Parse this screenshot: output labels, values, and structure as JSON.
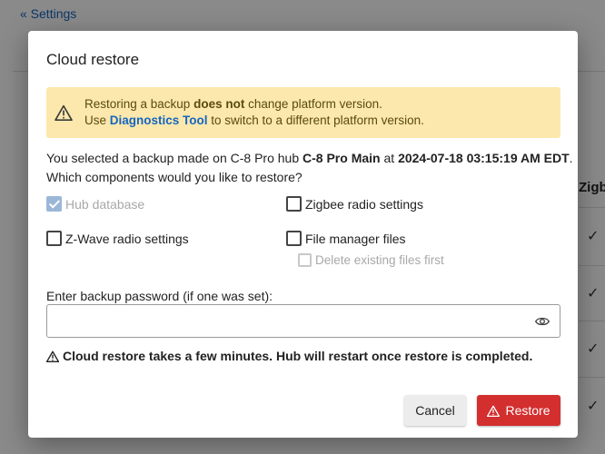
{
  "background": {
    "back_link": "« Settings",
    "column_header": "Zigb",
    "check_glyph": "✓"
  },
  "modal": {
    "title": "Cloud restore",
    "warning": {
      "icon": "warning-icon",
      "line1_pre": "Restoring a backup ",
      "line1_bold": "does not",
      "line1_post": " change platform version.",
      "line2_pre": "Use ",
      "line2_link": "Diagnostics Tool",
      "line2_post": " to switch to a different platform version."
    },
    "description": {
      "pre": "You selected a backup made on C-8 Pro hub ",
      "hub_name": "C-8 Pro Main",
      "mid": " at ",
      "timestamp": "2024-07-18 03:15:19 AM EDT",
      "post": ".",
      "question": "Which components would you like to restore?"
    },
    "options": {
      "hub_database": "Hub database",
      "zigbee": "Zigbee radio settings",
      "zwave": "Z-Wave radio settings",
      "file_manager": "File manager files",
      "delete_existing": "Delete existing files first"
    },
    "password": {
      "label": "Enter backup password (if one was set):",
      "value": "",
      "placeholder": ""
    },
    "notice": "Cloud restore takes a few minutes. Hub will restart once restore is completed.",
    "buttons": {
      "cancel": "Cancel",
      "restore": "Restore"
    },
    "colors": {
      "warning_bg": "#fce8ac",
      "link": "#1565c0",
      "danger": "#d32f2f"
    }
  }
}
